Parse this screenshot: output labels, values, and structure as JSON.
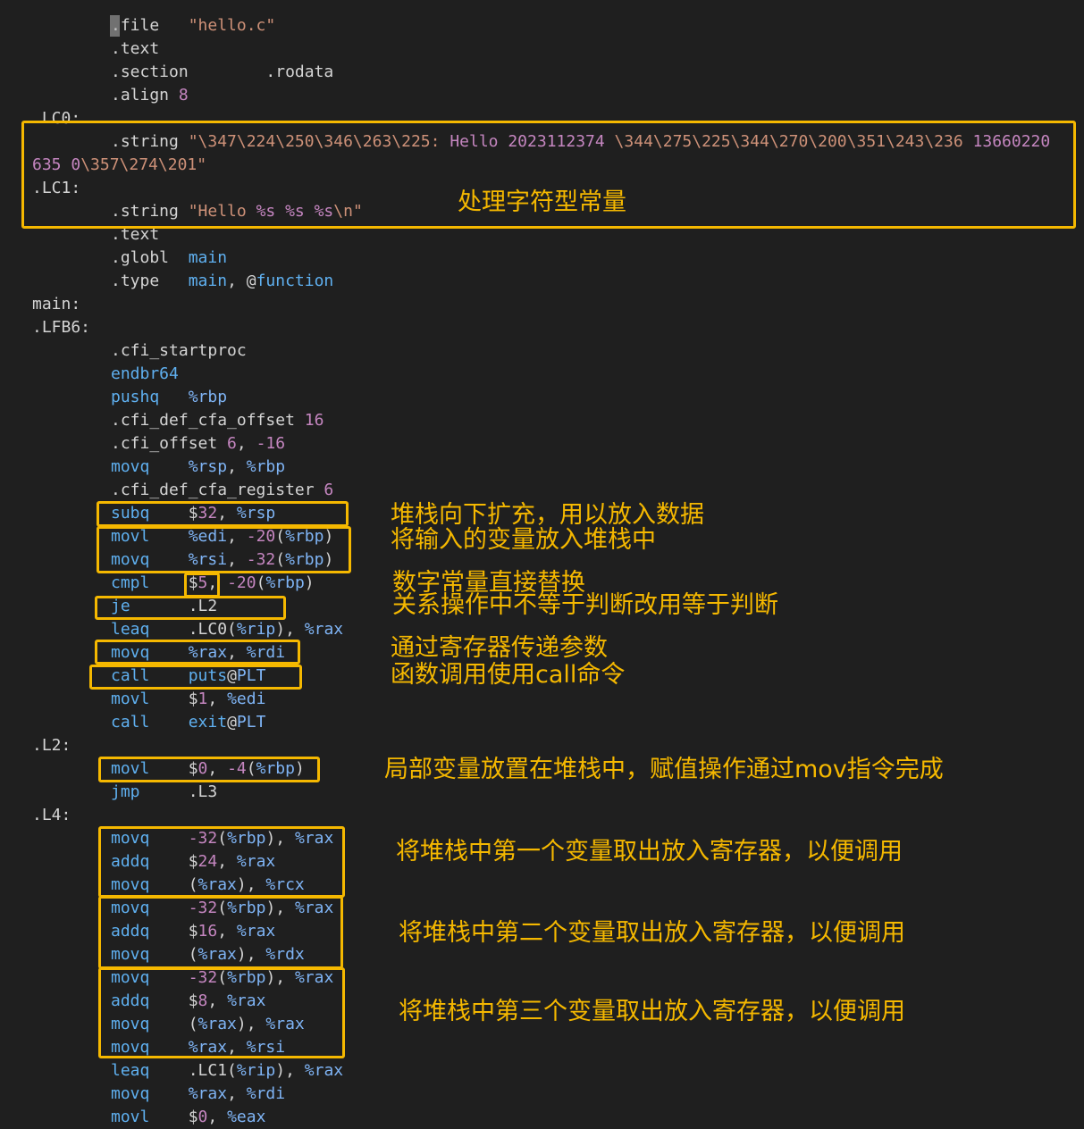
{
  "theme": {
    "background": "#1f1f1f",
    "default_text": "#d4d4d4",
    "keyword": "#5fb0f0",
    "string": "#ce9178",
    "number": "#c586c0",
    "register": "#7fb4f5",
    "annotation": "#f5b800"
  },
  "code": {
    "lines": [
      {
        "indent": 1,
        "tokens": [
          [
            ".file   ",
            "d"
          ],
          [
            "\"hello.c\"",
            "s"
          ]
        ]
      },
      {
        "indent": 1,
        "tokens": [
          [
            ".text",
            "d"
          ]
        ]
      },
      {
        "indent": 1,
        "tokens": [
          [
            ".section        .rodata",
            "d"
          ]
        ]
      },
      {
        "indent": 1,
        "tokens": [
          [
            ".align ",
            "d"
          ],
          [
            "8",
            "n"
          ]
        ]
      },
      {
        "indent": 0,
        "tokens": [
          [
            ".LC0:",
            "d"
          ]
        ]
      },
      {
        "indent": 1,
        "tokens": [
          [
            ".string ",
            "d"
          ],
          [
            "\"\\347\\224\\250\\346\\263\\225: ",
            "s"
          ],
          [
            "Hello ",
            "n"
          ],
          [
            "2023112374",
            "n"
          ],
          [
            " \\344\\275\\225\\344\\270\\200\\351\\243\\236 ",
            "s"
          ],
          [
            "13660220",
            "n"
          ]
        ]
      },
      {
        "indent": 0,
        "tokens": [
          [
            "635 ",
            "n"
          ],
          [
            "0",
            "n"
          ],
          [
            "\\357\\274\\201\"",
            "s"
          ]
        ]
      },
      {
        "indent": 0,
        "tokens": [
          [
            ".LC1:",
            "d"
          ]
        ]
      },
      {
        "indent": 1,
        "tokens": [
          [
            ".string ",
            "d"
          ],
          [
            "\"Hello ",
            "s"
          ],
          [
            "%s %s %s",
            "n"
          ],
          [
            "\\n\"",
            "s"
          ]
        ]
      },
      {
        "indent": 1,
        "tokens": [
          [
            ".text",
            "d"
          ]
        ]
      },
      {
        "indent": 1,
        "tokens": [
          [
            ".globl  ",
            "d"
          ],
          [
            "main",
            "k"
          ]
        ]
      },
      {
        "indent": 1,
        "tokens": [
          [
            ".type   ",
            "d"
          ],
          [
            "main",
            "k"
          ],
          [
            ", @",
            "d"
          ],
          [
            "function",
            "k"
          ]
        ]
      },
      {
        "indent": 0,
        "tokens": [
          [
            "main:",
            "d"
          ]
        ]
      },
      {
        "indent": 0,
        "tokens": [
          [
            ".LFB6:",
            "d"
          ]
        ]
      },
      {
        "indent": 1,
        "tokens": [
          [
            ".cfi_startproc",
            "d"
          ]
        ]
      },
      {
        "indent": 1,
        "tokens": [
          [
            "endbr64",
            "k"
          ]
        ]
      },
      {
        "indent": 1,
        "tokens": [
          [
            "pushq",
            "k"
          ],
          [
            "   %rbp",
            "b"
          ]
        ]
      },
      {
        "indent": 1,
        "tokens": [
          [
            ".cfi_def_cfa_offset ",
            "d"
          ],
          [
            "16",
            "n"
          ]
        ]
      },
      {
        "indent": 1,
        "tokens": [
          [
            ".cfi_offset ",
            "d"
          ],
          [
            "6",
            "n"
          ],
          [
            ", ",
            "d"
          ],
          [
            "-16",
            "n"
          ]
        ]
      },
      {
        "indent": 1,
        "tokens": [
          [
            "movq",
            "k"
          ],
          [
            "    %rsp",
            "b"
          ],
          [
            ", ",
            "d"
          ],
          [
            "%rbp",
            "b"
          ]
        ]
      },
      {
        "indent": 1,
        "tokens": [
          [
            ".cfi_def_cfa_register ",
            "d"
          ],
          [
            "6",
            "n"
          ]
        ]
      },
      {
        "indent": 1,
        "tokens": [
          [
            "subq",
            "k"
          ],
          [
            "    $",
            "d"
          ],
          [
            "32",
            "n"
          ],
          [
            ", ",
            "d"
          ],
          [
            "%rsp",
            "b"
          ]
        ]
      },
      {
        "indent": 1,
        "tokens": [
          [
            "movl",
            "k"
          ],
          [
            "    %edi",
            "b"
          ],
          [
            ", ",
            "d"
          ],
          [
            "-20",
            "n"
          ],
          [
            "(",
            "d"
          ],
          [
            "%rbp",
            "b"
          ],
          [
            ")",
            "d"
          ]
        ]
      },
      {
        "indent": 1,
        "tokens": [
          [
            "movq",
            "k"
          ],
          [
            "    %rsi",
            "b"
          ],
          [
            ", ",
            "d"
          ],
          [
            "-32",
            "n"
          ],
          [
            "(",
            "d"
          ],
          [
            "%rbp",
            "b"
          ],
          [
            ")",
            "d"
          ]
        ]
      },
      {
        "indent": 1,
        "tokens": [
          [
            "cmpl",
            "k"
          ],
          [
            "    $",
            "d"
          ],
          [
            "5",
            "n"
          ],
          [
            ", ",
            "d"
          ],
          [
            "-20",
            "n"
          ],
          [
            "(",
            "d"
          ],
          [
            "%rbp",
            "b"
          ],
          [
            ")",
            "d"
          ]
        ]
      },
      {
        "indent": 1,
        "tokens": [
          [
            "je",
            "k"
          ],
          [
            "      .L2",
            "d"
          ]
        ]
      },
      {
        "indent": 1,
        "tokens": [
          [
            "leaq",
            "k"
          ],
          [
            "    .LC0(",
            "d"
          ],
          [
            "%rip",
            "b"
          ],
          [
            "), ",
            "d"
          ],
          [
            "%rax",
            "b"
          ]
        ]
      },
      {
        "indent": 1,
        "tokens": [
          [
            "movq",
            "k"
          ],
          [
            "    %rax",
            "b"
          ],
          [
            ", ",
            "d"
          ],
          [
            "%rdi",
            "b"
          ]
        ]
      },
      {
        "indent": 1,
        "tokens": [
          [
            "call",
            "k"
          ],
          [
            "    ",
            "d"
          ],
          [
            "puts",
            "k"
          ],
          [
            "@",
            "d"
          ],
          [
            "PLT",
            "b"
          ]
        ]
      },
      {
        "indent": 1,
        "tokens": [
          [
            "movl",
            "k"
          ],
          [
            "    $",
            "d"
          ],
          [
            "1",
            "n"
          ],
          [
            ", ",
            "d"
          ],
          [
            "%edi",
            "b"
          ]
        ]
      },
      {
        "indent": 1,
        "tokens": [
          [
            "call",
            "k"
          ],
          [
            "    ",
            "d"
          ],
          [
            "exit",
            "k"
          ],
          [
            "@",
            "d"
          ],
          [
            "PLT",
            "b"
          ]
        ]
      },
      {
        "indent": 0,
        "tokens": [
          [
            ".L2:",
            "d"
          ]
        ]
      },
      {
        "indent": 1,
        "tokens": [
          [
            "movl",
            "k"
          ],
          [
            "    $",
            "d"
          ],
          [
            "0",
            "n"
          ],
          [
            ", ",
            "d"
          ],
          [
            "-4",
            "n"
          ],
          [
            "(",
            "d"
          ],
          [
            "%rbp",
            "b"
          ],
          [
            ")",
            "d"
          ]
        ]
      },
      {
        "indent": 1,
        "tokens": [
          [
            "jmp",
            "k"
          ],
          [
            "     .L3",
            "d"
          ]
        ]
      },
      {
        "indent": 0,
        "tokens": [
          [
            ".L4:",
            "d"
          ]
        ]
      },
      {
        "indent": 1,
        "tokens": [
          [
            "movq",
            "k"
          ],
          [
            "    ",
            "d"
          ],
          [
            "-32",
            "n"
          ],
          [
            "(",
            "d"
          ],
          [
            "%rbp",
            "b"
          ],
          [
            "), ",
            "d"
          ],
          [
            "%rax",
            "b"
          ]
        ]
      },
      {
        "indent": 1,
        "tokens": [
          [
            "addq",
            "k"
          ],
          [
            "    $",
            "d"
          ],
          [
            "24",
            "n"
          ],
          [
            ", ",
            "d"
          ],
          [
            "%rax",
            "b"
          ]
        ]
      },
      {
        "indent": 1,
        "tokens": [
          [
            "movq",
            "k"
          ],
          [
            "    (",
            "d"
          ],
          [
            "%rax",
            "b"
          ],
          [
            "), ",
            "d"
          ],
          [
            "%rcx",
            "b"
          ]
        ]
      },
      {
        "indent": 1,
        "tokens": [
          [
            "movq",
            "k"
          ],
          [
            "    ",
            "d"
          ],
          [
            "-32",
            "n"
          ],
          [
            "(",
            "d"
          ],
          [
            "%rbp",
            "b"
          ],
          [
            "), ",
            "d"
          ],
          [
            "%rax",
            "b"
          ]
        ]
      },
      {
        "indent": 1,
        "tokens": [
          [
            "addq",
            "k"
          ],
          [
            "    $",
            "d"
          ],
          [
            "16",
            "n"
          ],
          [
            ", ",
            "d"
          ],
          [
            "%rax",
            "b"
          ]
        ]
      },
      {
        "indent": 1,
        "tokens": [
          [
            "movq",
            "k"
          ],
          [
            "    (",
            "d"
          ],
          [
            "%rax",
            "b"
          ],
          [
            "), ",
            "d"
          ],
          [
            "%rdx",
            "b"
          ]
        ]
      },
      {
        "indent": 1,
        "tokens": [
          [
            "movq",
            "k"
          ],
          [
            "    ",
            "d"
          ],
          [
            "-32",
            "n"
          ],
          [
            "(",
            "d"
          ],
          [
            "%rbp",
            "b"
          ],
          [
            "), ",
            "d"
          ],
          [
            "%rax",
            "b"
          ]
        ]
      },
      {
        "indent": 1,
        "tokens": [
          [
            "addq",
            "k"
          ],
          [
            "    $",
            "d"
          ],
          [
            "8",
            "n"
          ],
          [
            ", ",
            "d"
          ],
          [
            "%rax",
            "b"
          ]
        ]
      },
      {
        "indent": 1,
        "tokens": [
          [
            "movq",
            "k"
          ],
          [
            "    (",
            "d"
          ],
          [
            "%rax",
            "b"
          ],
          [
            "), ",
            "d"
          ],
          [
            "%rax",
            "b"
          ]
        ]
      },
      {
        "indent": 1,
        "tokens": [
          [
            "movq",
            "k"
          ],
          [
            "    %rax",
            "b"
          ],
          [
            ", ",
            "d"
          ],
          [
            "%rsi",
            "b"
          ]
        ]
      },
      {
        "indent": 1,
        "tokens": [
          [
            "leaq",
            "k"
          ],
          [
            "    .LC1(",
            "d"
          ],
          [
            "%rip",
            "b"
          ],
          [
            "), ",
            "d"
          ],
          [
            "%rax",
            "b"
          ]
        ]
      },
      {
        "indent": 1,
        "tokens": [
          [
            "movq",
            "k"
          ],
          [
            "    %rax",
            "b"
          ],
          [
            ", ",
            "d"
          ],
          [
            "%rdi",
            "b"
          ]
        ]
      },
      {
        "indent": 1,
        "tokens": [
          [
            "movl",
            "k"
          ],
          [
            "    $",
            "d"
          ],
          [
            "0",
            "n"
          ],
          [
            ", ",
            "d"
          ],
          [
            "%eax",
            "b"
          ]
        ]
      }
    ]
  },
  "annotations": [
    {
      "id": "char-constants",
      "text": "处理字符型常量"
    },
    {
      "id": "stack-grow",
      "text": "堆栈向下扩充，用以放入数据"
    },
    {
      "id": "store-vars",
      "text": "将输入的变量放入堆栈中"
    },
    {
      "id": "numeric-const",
      "text": "数字常量直接替换"
    },
    {
      "id": "relational-op",
      "text": "关系操作中不等于判断改用等于判断"
    },
    {
      "id": "pass-args",
      "text": "通过寄存器传递参数"
    },
    {
      "id": "call-instr",
      "text": "函数调用使用call命令"
    },
    {
      "id": "local-var",
      "text": "局部变量放置在堆栈中，赋值操作通过mov指令完成"
    },
    {
      "id": "arg-1",
      "text": "将堆栈中第一个变量取出放入寄存器，以便调用"
    },
    {
      "id": "arg-2",
      "text": "将堆栈中第二个变量取出放入寄存器，以便调用"
    },
    {
      "id": "arg-3",
      "text": "将堆栈中第三个变量取出放入寄存器，以便调用"
    }
  ]
}
